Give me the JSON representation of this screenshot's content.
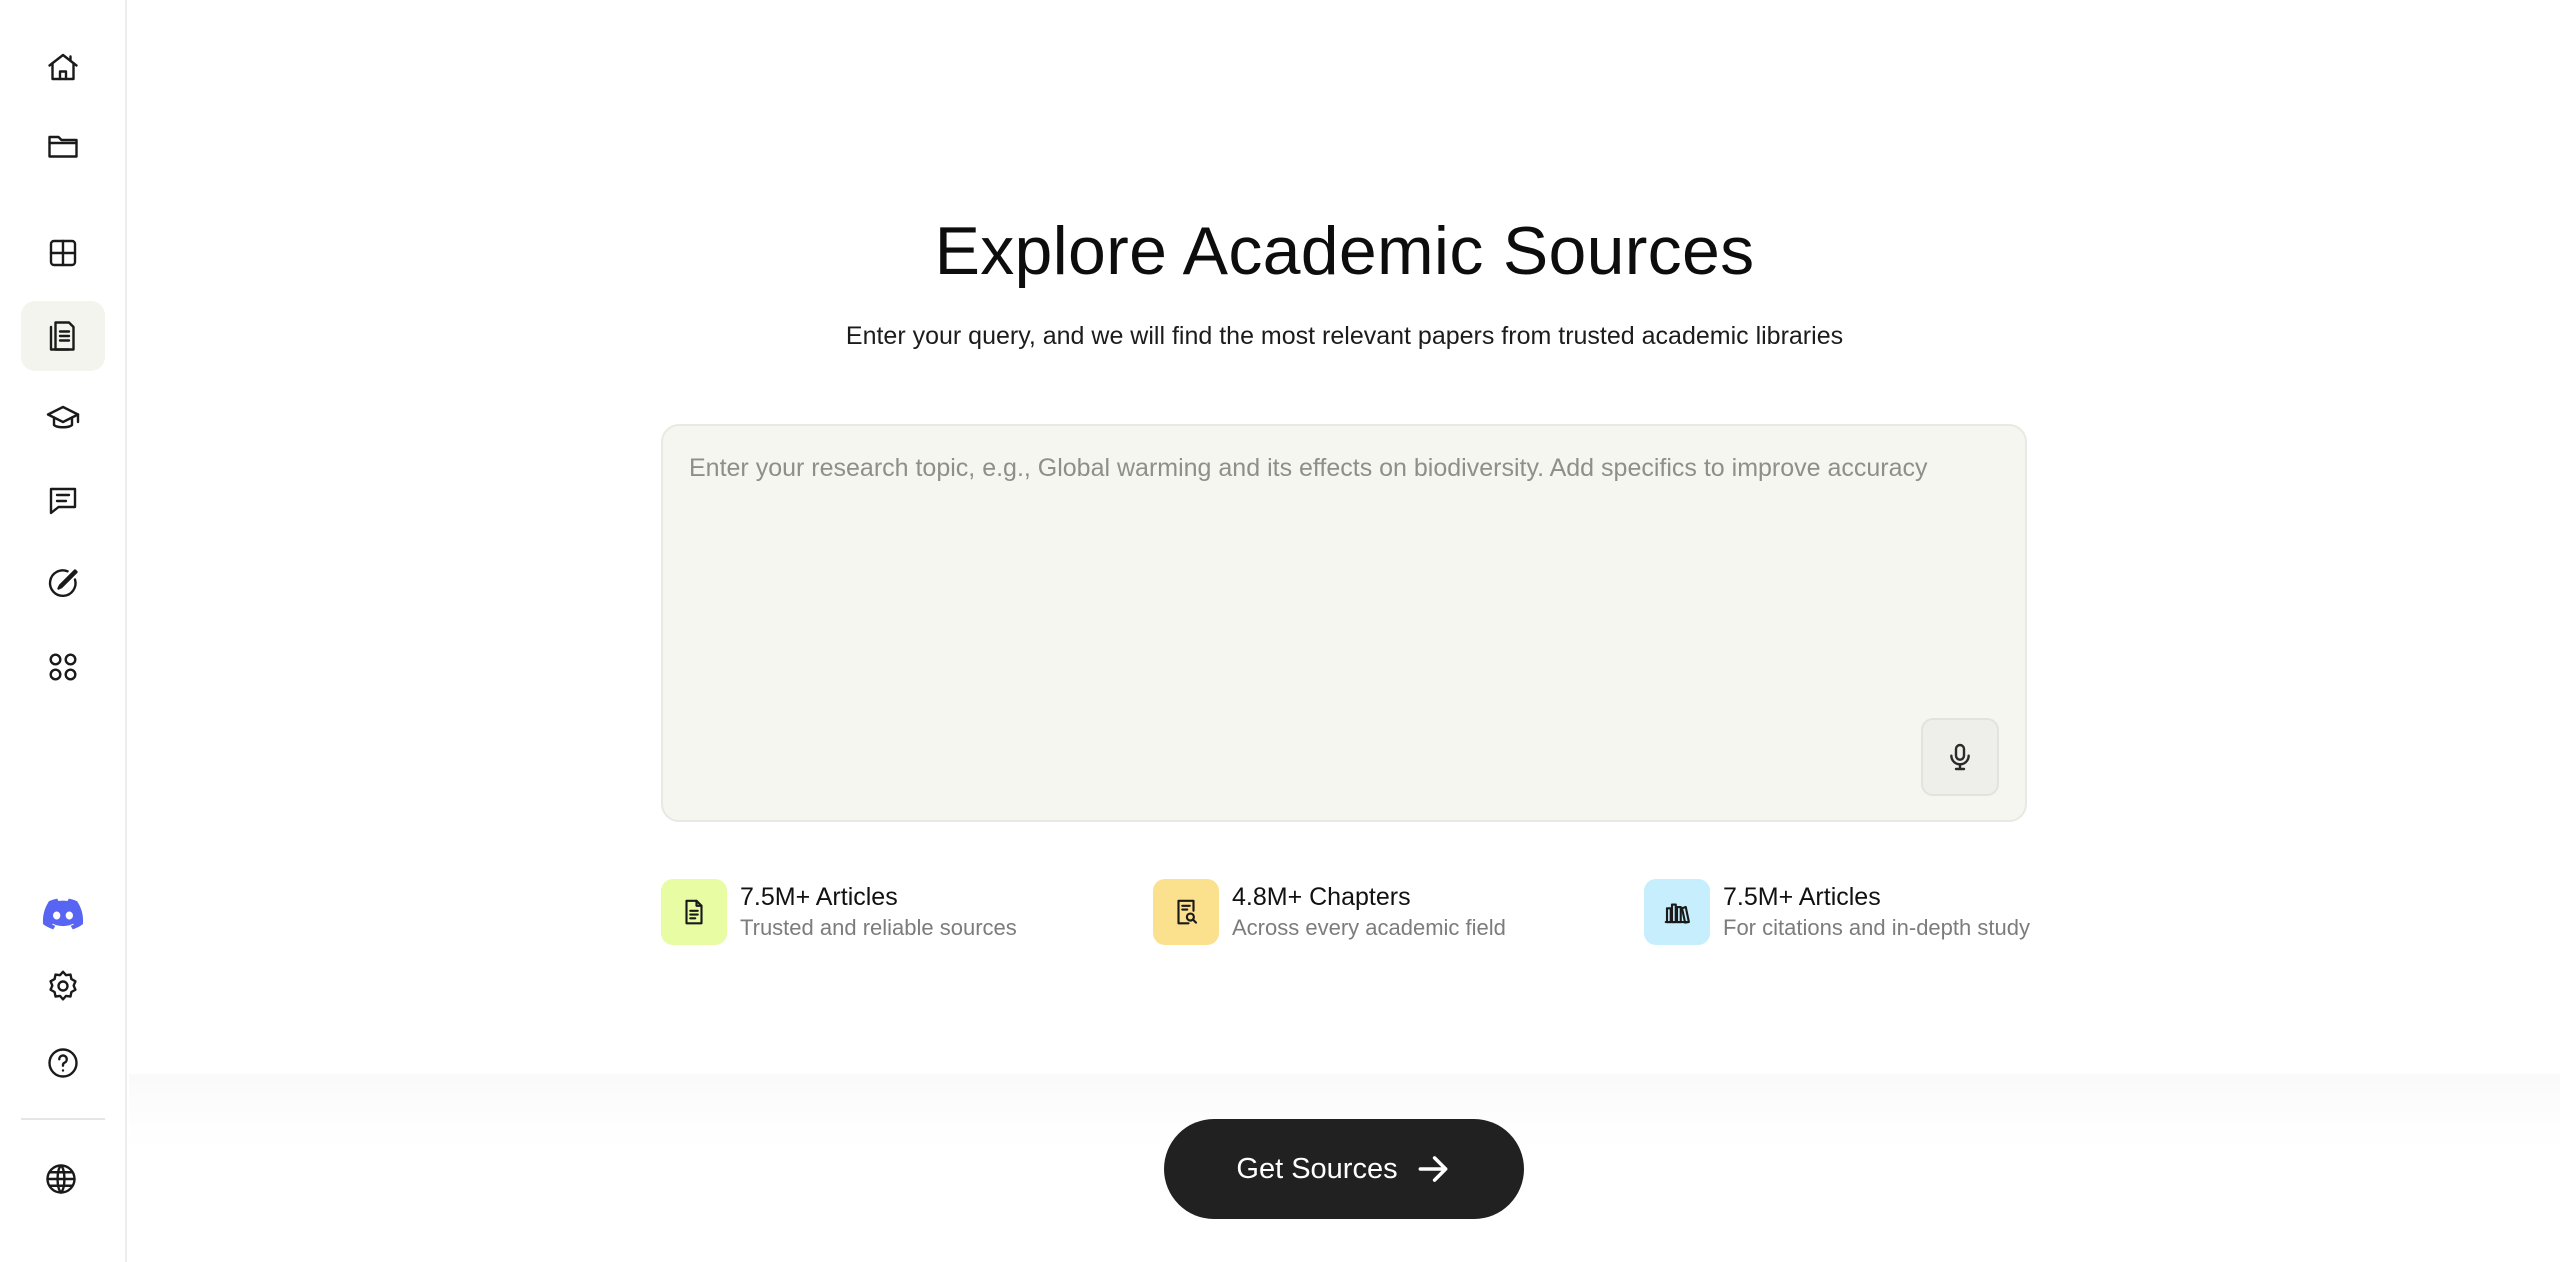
{
  "sidebar": {
    "items": [
      {
        "icon": "home-icon"
      },
      {
        "icon": "folder-icon"
      },
      {
        "icon": "grid-icon"
      },
      {
        "icon": "document-icon",
        "active": true
      },
      {
        "icon": "graduation-cap-icon"
      },
      {
        "icon": "chat-icon"
      },
      {
        "icon": "pen-circle-icon"
      },
      {
        "icon": "apps-icon"
      }
    ],
    "bottom_items": [
      {
        "icon": "discord-icon"
      },
      {
        "icon": "gear-icon"
      },
      {
        "icon": "help-icon"
      },
      {
        "icon": "globe-icon"
      }
    ]
  },
  "main": {
    "title": "Explore Academic Sources",
    "subtitle": "Enter your query, and we will find the most relevant papers from trusted academic libraries",
    "query": {
      "value": "",
      "placeholder": "Enter your research topic, e.g., Global warming and its effects on biodiversity. Add specifics to improve accuracy"
    },
    "stats": [
      {
        "title": "7.5M+ Articles",
        "description": "Trusted and reliable sources",
        "icon": "document-icon",
        "color": "#e8fca4"
      },
      {
        "title": "4.8M+ Chapters",
        "description": "Across every academic field",
        "icon": "document-search-icon",
        "color": "#fbe08e"
      },
      {
        "title": "7.5M+ Articles",
        "description": "For citations and in-depth study",
        "icon": "library-icon",
        "color": "#c6eefc"
      }
    ],
    "cta": {
      "label": "Get Sources",
      "icon": "arrow-right-icon"
    }
  },
  "colors": {
    "accent_dark": "#212121",
    "discord": "#5865f2",
    "active_nav_bg": "#f4f4ee",
    "query_bg": "#f6f6f1"
  }
}
